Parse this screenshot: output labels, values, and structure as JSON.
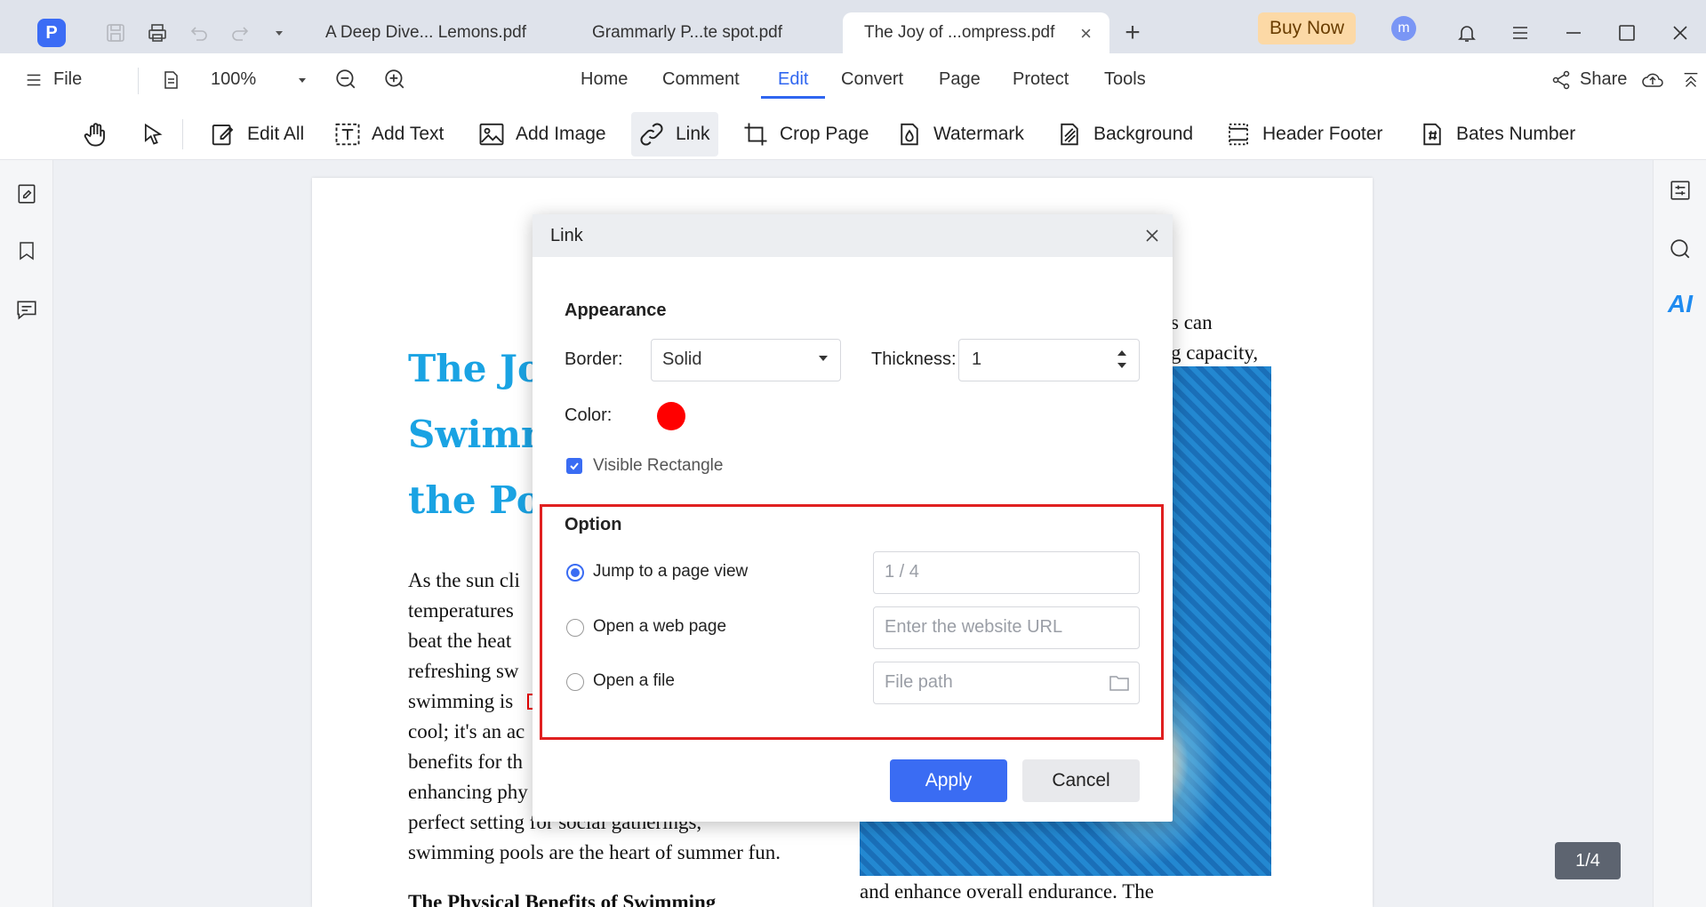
{
  "titlebar": {
    "app_logo": "P",
    "tabs": [
      {
        "label": "A Deep Dive... Lemons.pdf"
      },
      {
        "label": "Grammarly P...te spot.pdf"
      },
      {
        "label": "The Joy of ...ompress.pdf",
        "close": "×"
      }
    ],
    "new_tab": "+",
    "buy_now": "Buy Now",
    "avatar_letter": "m"
  },
  "menubar": {
    "file_label": "File",
    "zoom": "100%",
    "items": [
      "Home",
      "Comment",
      "Edit",
      "Convert",
      "Page",
      "Protect",
      "Tools"
    ],
    "active_item": "Edit",
    "share_label": "Share"
  },
  "toolbar": {
    "tools": [
      "Edit All",
      "Add Text",
      "Add Image",
      "Link",
      "Crop Page",
      "Watermark",
      "Background",
      "Header  Footer",
      "Bates Number"
    ],
    "active_tool": "Link"
  },
  "right_rail": {
    "ai_label": "AI"
  },
  "document": {
    "title_lines": [
      "The Joy",
      "Swimm",
      "the Poo"
    ],
    "body_lines": [
      "As the sun cli",
      "temperatures",
      "beat the heat",
      "refreshing sw",
      "swimming is",
      "cool; it's an ac",
      "benefits for th",
      "enhancing phy",
      "perfect setting for social gatherings,",
      "swimming pools are the heart of summer fun."
    ],
    "right_lines": [
      "s can",
      "g capacity,"
    ],
    "bottom_right_line": "and enhance overall endurance. The",
    "bottom_left_line": "The Physical Benefits of Swimming"
  },
  "page_indicator": "1/4",
  "dialog": {
    "title": "Link",
    "appearance": {
      "heading": "Appearance",
      "border_label": "Border:",
      "border_value": "Solid",
      "thickness_label": "Thickness:",
      "thickness_value": "1",
      "color_label": "Color:",
      "color_value": "#ff0000",
      "visible_rectangle_label": "Visible Rectangle",
      "visible_rectangle_checked": true
    },
    "option": {
      "heading": "Option",
      "choices": [
        {
          "label": "Jump to a page view",
          "checked": true,
          "field_value": "1 / 4"
        },
        {
          "label": "Open a web page",
          "checked": false,
          "field_placeholder": "Enter the website URL"
        },
        {
          "label": "Open a file",
          "checked": false,
          "field_placeholder": "File path"
        }
      ]
    },
    "apply_label": "Apply",
    "cancel_label": "Cancel"
  },
  "colors": {
    "accent": "#3a6cf3",
    "title_blue": "#1aa3e3",
    "highlight_red": "#e02020"
  }
}
